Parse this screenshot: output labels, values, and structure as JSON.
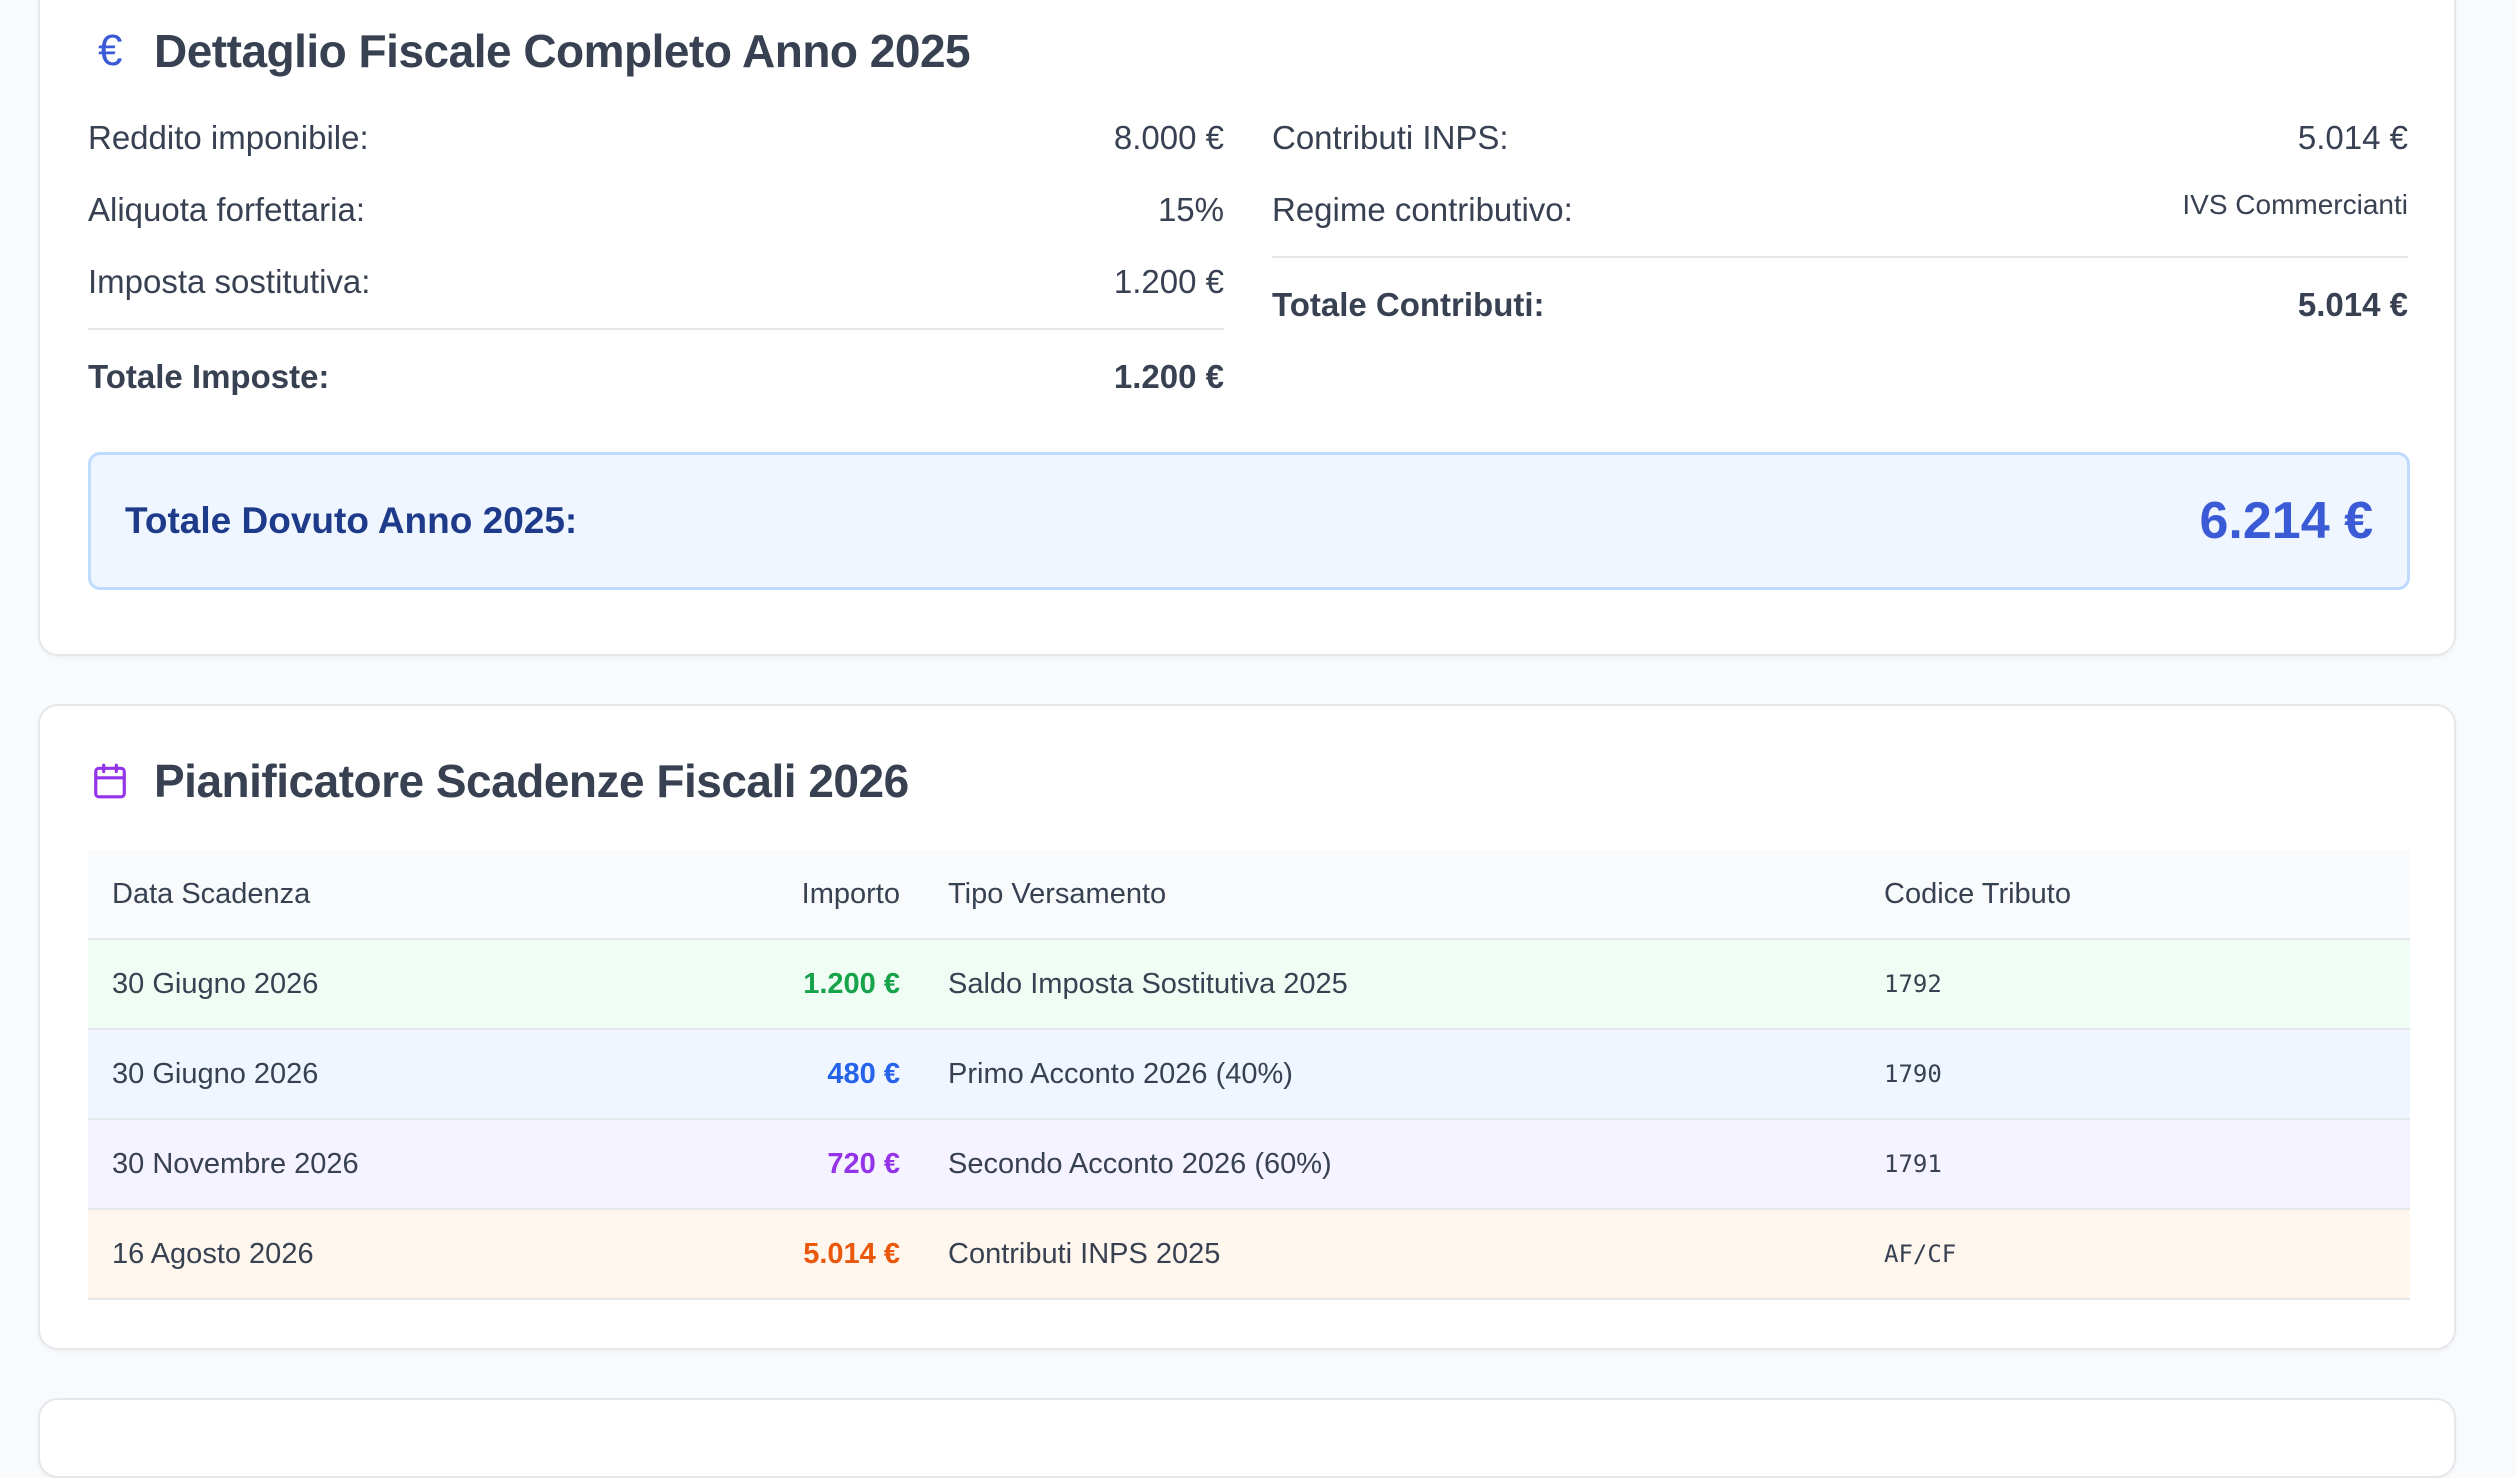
{
  "fiscal": {
    "title": "Dettaglio Fiscale Completo Anno 2025",
    "icon": "euro-icon",
    "left_rows": [
      {
        "label": "Reddito imponibile:",
        "value": "8.000 €"
      },
      {
        "label": "Aliquota forfettaria:",
        "value": "15%"
      },
      {
        "label": "Imposta sostitutiva:",
        "value": "1.200 €"
      }
    ],
    "left_total": {
      "label": "Totale Imposte:",
      "value": "1.200 €"
    },
    "right_rows": [
      {
        "label": "Contributi INPS:",
        "value": "5.014 €"
      },
      {
        "label": "Regime contributivo:",
        "value": "IVS Commercianti"
      }
    ],
    "right_total": {
      "label": "Totale Contributi:",
      "value": "5.014 €"
    },
    "grand_total": {
      "label": "Totale Dovuto Anno 2025:",
      "value": "6.214 €"
    }
  },
  "planner": {
    "title": "Pianificatore Scadenze Fiscali 2026",
    "icon": "calendar-icon",
    "headers": {
      "date": "Data Scadenza",
      "amount": "Importo",
      "type": "Tipo Versamento",
      "code": "Codice Tributo"
    },
    "rows": [
      {
        "date": "30 Giugno 2026",
        "amount": "1.200 €",
        "type": "Saldo Imposta Sostitutiva 2025",
        "code": "1792",
        "bg": "#f0fdf4",
        "color": "#16a34a"
      },
      {
        "date": "30 Giugno 2026",
        "amount": "480 €",
        "type": "Primo Acconto 2026 (40%)",
        "code": "1790",
        "bg": "#eff6ff",
        "color": "#2563eb"
      },
      {
        "date": "30 Novembre 2026",
        "amount": "720 €",
        "type": "Secondo Acconto 2026 (60%)",
        "code": "1791",
        "bg": "#f5f3ff",
        "color": "#9333ea"
      },
      {
        "date": "16 Agosto 2026",
        "amount": "5.014 €",
        "type": "Contributi INPS 2025",
        "code": "AF/CF",
        "bg": "#fff7ed",
        "color": "#ea580c"
      }
    ]
  },
  "colors": {
    "accent_blue": "#3b5bd6",
    "calendar_purple": "#9333ea"
  }
}
